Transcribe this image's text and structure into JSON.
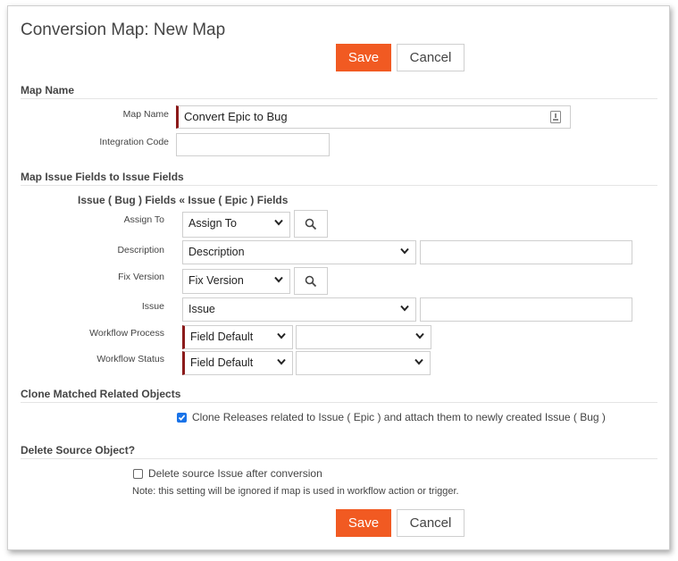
{
  "page_title": "Conversion Map: New Map",
  "buttons": {
    "save": "Save",
    "cancel": "Cancel"
  },
  "section_map_name": {
    "heading": "Map Name",
    "map_name_label": "Map Name",
    "map_name_value": "Convert Epic to Bug",
    "integration_code_label": "Integration Code",
    "integration_code_value": ""
  },
  "section_fields": {
    "heading": "Map Issue Fields to Issue Fields",
    "target_header": "Issue ( Bug ) Fields",
    "arrow": "«",
    "source_header": "Issue ( Epic ) Fields",
    "rows": [
      {
        "label": "Assign To",
        "select": "Assign To"
      },
      {
        "label": "Description",
        "select": "Description"
      },
      {
        "label": "Fix Version",
        "select": "Fix Version"
      },
      {
        "label": "Issue",
        "select": "Issue"
      },
      {
        "label": "Workflow Process",
        "select": "Field Default",
        "second": ""
      },
      {
        "label": "Workflow Status",
        "select": "Field Default",
        "second": ""
      }
    ]
  },
  "section_clone": {
    "heading": "Clone Matched Related Objects",
    "checkbox_label": "Clone Releases related to Issue ( Epic ) and attach them to newly created Issue ( Bug )",
    "checked": true
  },
  "section_delete": {
    "heading": "Delete Source Object?",
    "checkbox_label": "Delete source Issue after conversion",
    "checked": false,
    "note": "Note: this setting will be ignored if map is used in workflow action or trigger."
  },
  "icons": {
    "dropdown": "chevron-down-icon",
    "lookup": "search-icon",
    "field_picker": "text-field-icon",
    "checkbox_check": "check-icon"
  },
  "colors": {
    "accent": "#f15a22",
    "required_marker": "#8b1a1a",
    "checkbox": "#1a73e8"
  }
}
